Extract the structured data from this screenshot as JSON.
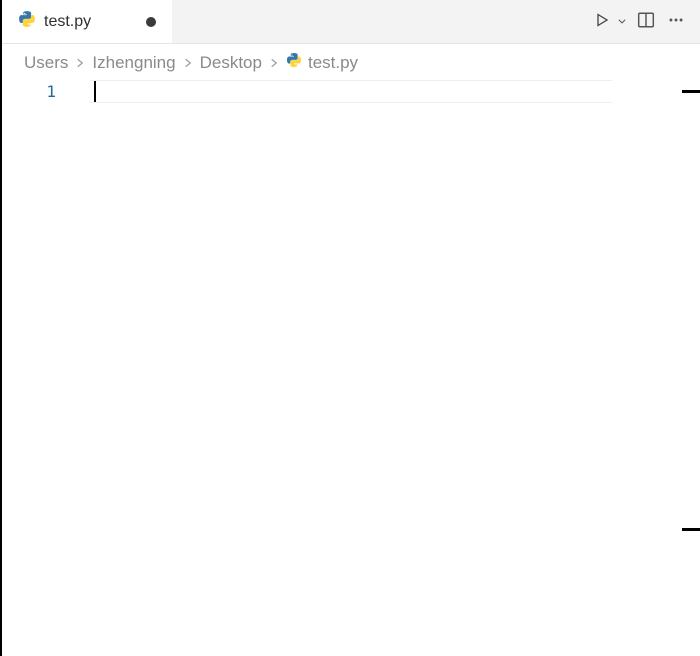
{
  "tab": {
    "filename": "test.py",
    "dirty": true
  },
  "actions": {
    "run_label": "Run",
    "split_label": "Split Editor",
    "more_label": "More Actions"
  },
  "breadcrumb": {
    "segments": [
      "Users",
      "Izhengning",
      "Desktop"
    ],
    "file": "test.py"
  },
  "editor": {
    "line_numbers": [
      "1"
    ],
    "lines": [
      ""
    ]
  }
}
